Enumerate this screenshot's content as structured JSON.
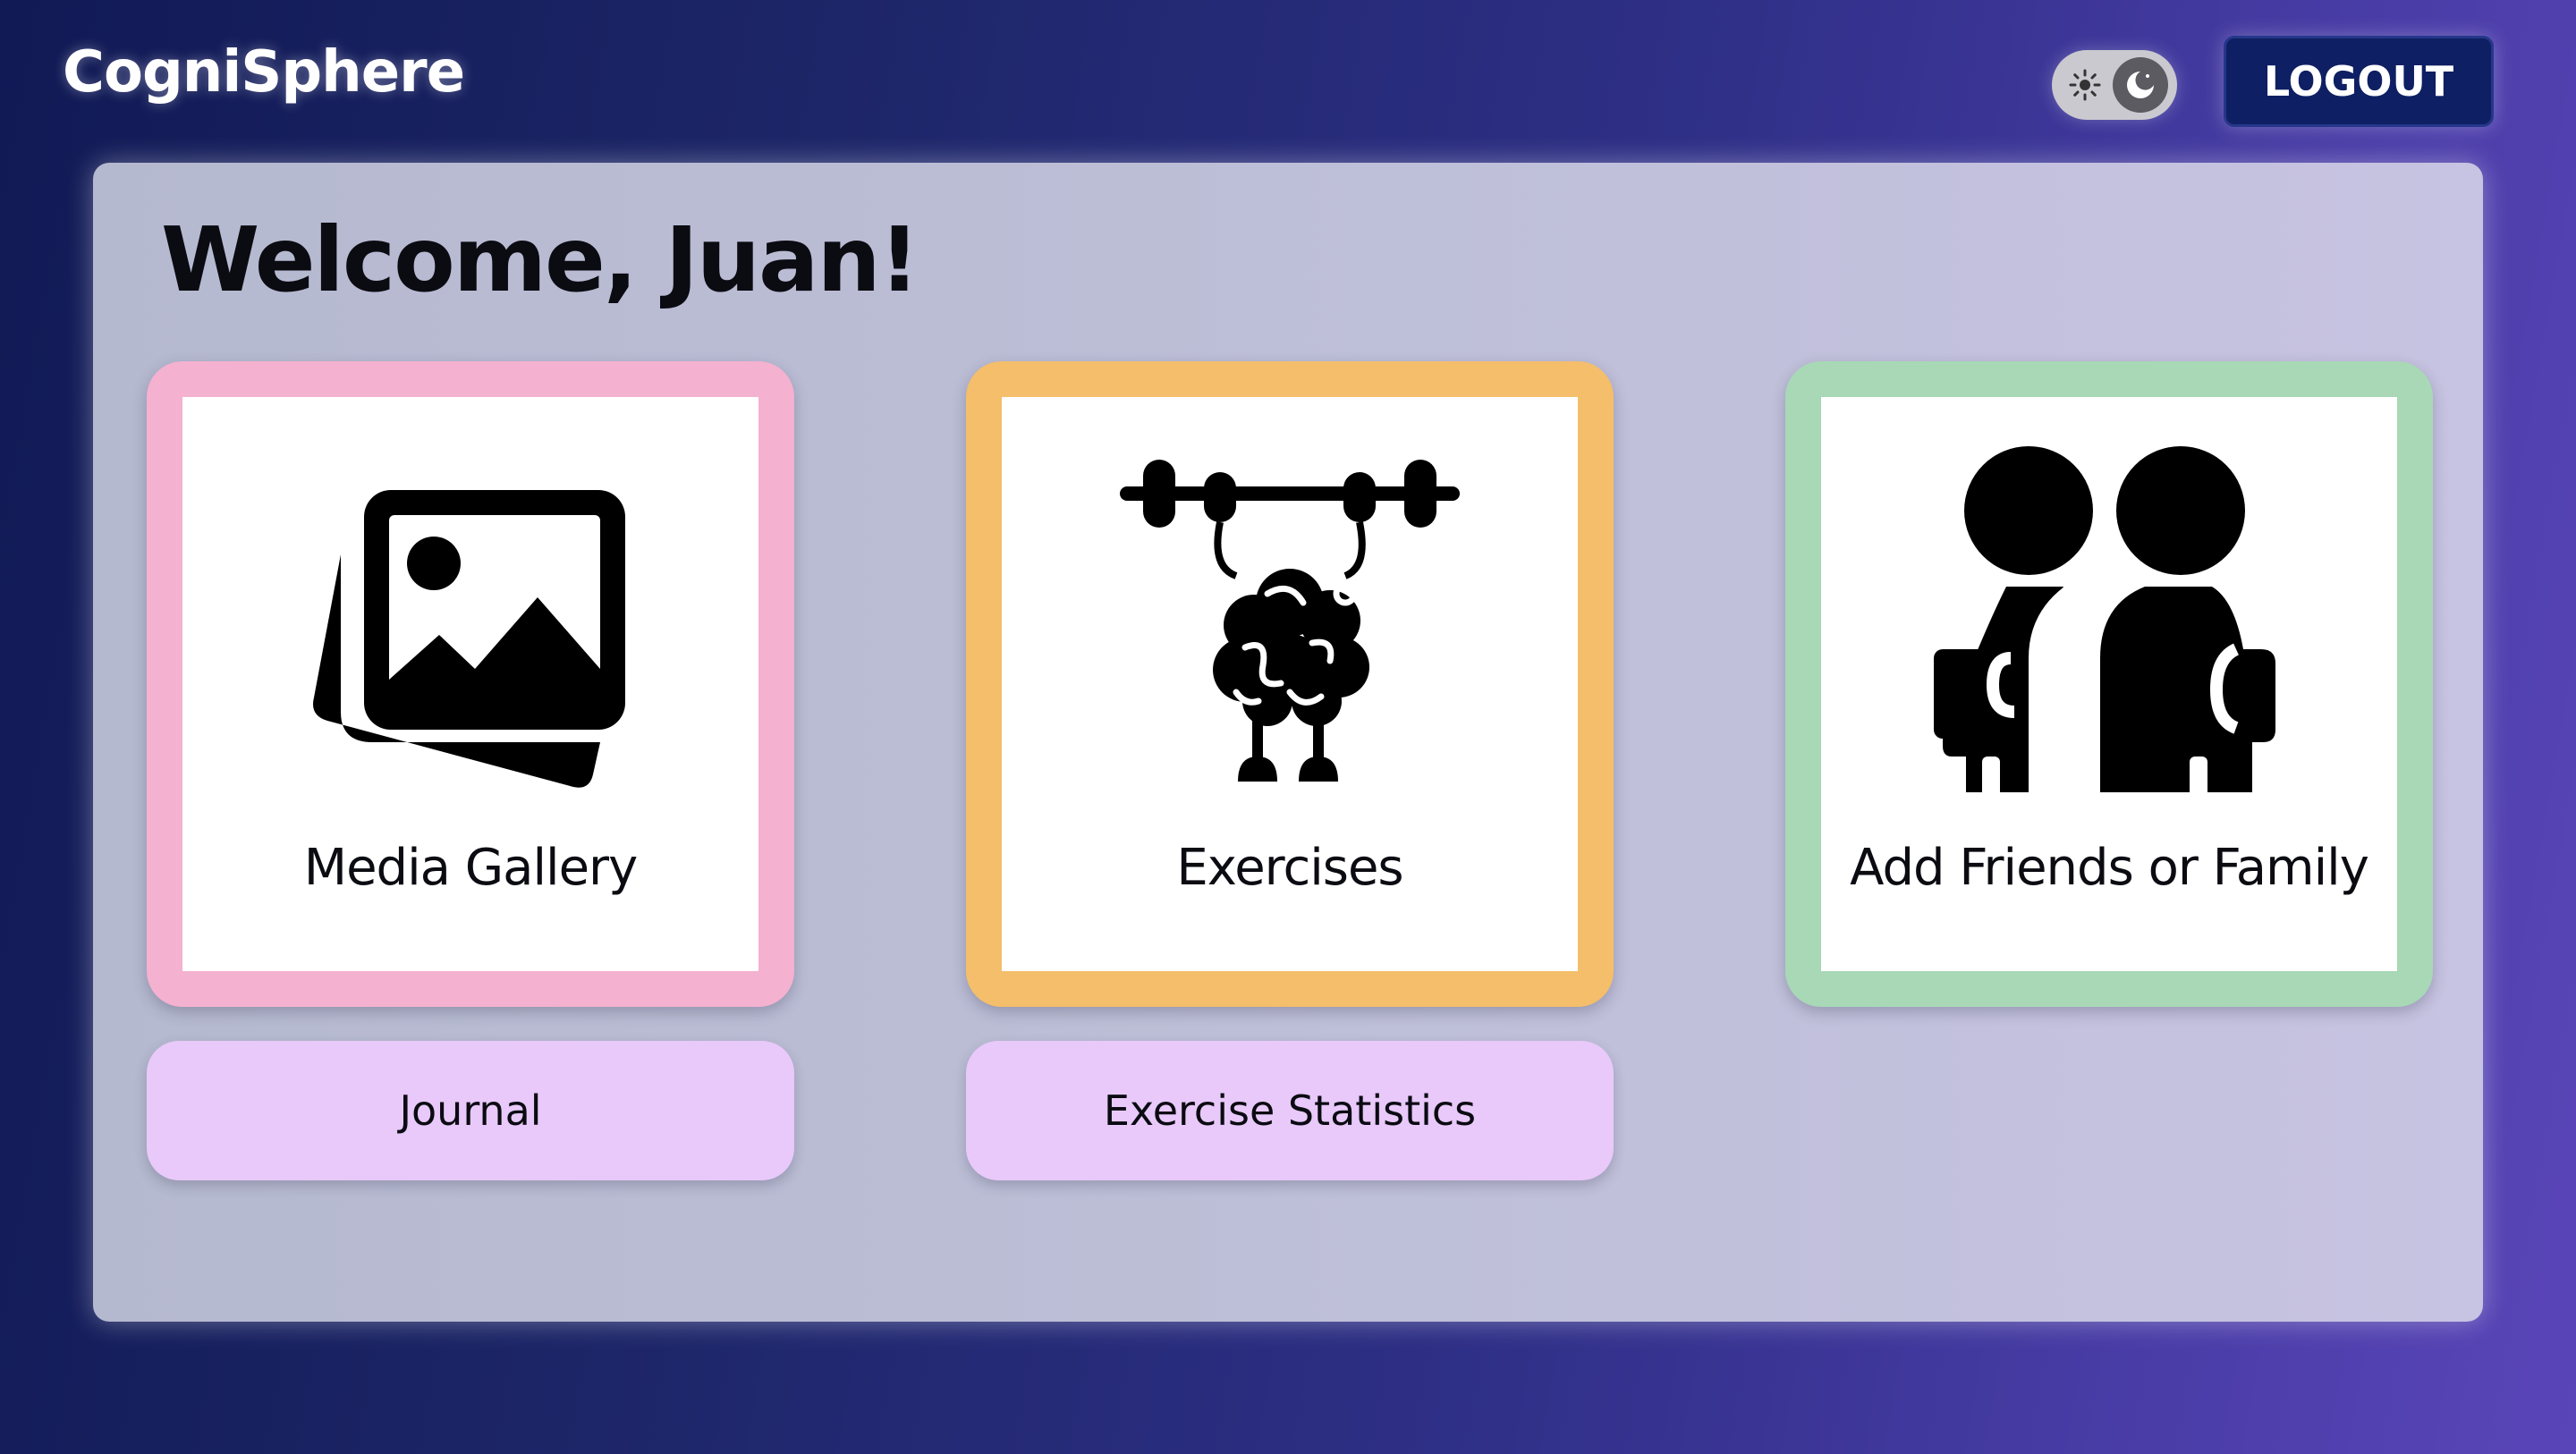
{
  "header": {
    "brand": "CogniSphere",
    "theme_toggle": {
      "icons": [
        "sun-icon",
        "moon-icon"
      ],
      "mode": "dark"
    },
    "logout_label": "LOGOUT"
  },
  "main": {
    "welcome": "Welcome, Juan!",
    "tiles": [
      {
        "label": "Media Gallery",
        "icon": "image-gallery-icon",
        "color": "#f4b1d0"
      },
      {
        "label": "Exercises",
        "icon": "brain-lifting-barbell-icon",
        "color": "#f4be6b"
      },
      {
        "label": "Add Friends or Family",
        "icon": "two-people-icon",
        "color": "#a8d8b6"
      }
    ],
    "buttons": [
      {
        "label": "Journal",
        "color": "#e8c9f9"
      },
      {
        "label": "Exercise Statistics",
        "color": "#e8c9f9"
      }
    ]
  },
  "colors": {
    "logout_bg": "#0f1f63",
    "panel_bg": "#bebfd8"
  }
}
